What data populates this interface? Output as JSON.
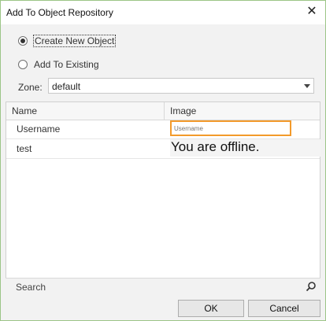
{
  "window": {
    "title": "Add To Object Repository"
  },
  "options": {
    "create_new": "Create New Object",
    "add_existing": "Add To Existing",
    "selected": "create_new"
  },
  "zone": {
    "label": "Zone:",
    "value": "default"
  },
  "table": {
    "columns": [
      "Name",
      "Image"
    ],
    "rows": [
      {
        "name": "Username",
        "image_placeholder": "Username"
      },
      {
        "name": "test",
        "image_text": "You are offline."
      }
    ]
  },
  "search": {
    "label": "Search"
  },
  "buttons": {
    "ok": "OK",
    "cancel": "Cancel"
  },
  "colors": {
    "focus_border": "#f39a2b",
    "window_border": "#9cc587"
  }
}
